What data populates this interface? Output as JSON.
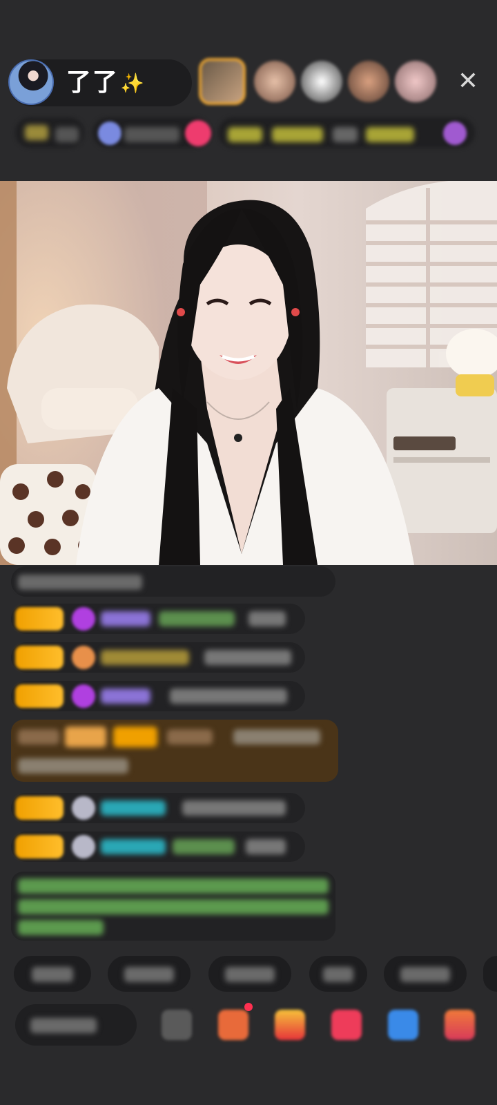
{
  "header": {
    "host_name": "了了",
    "host_sparkle": "✨"
  },
  "icons": {
    "close": "close-icon",
    "sparkle": "sparkle-icon"
  },
  "colors": {
    "background": "#2a2a2c",
    "pill": "#1d1d1f",
    "badge_gold": "#f0a000",
    "username_purple": "#8b73d6",
    "username_teal": "#2aa7b5",
    "message_green": "#7bd36a",
    "highlight_brown": "#4a3418"
  }
}
